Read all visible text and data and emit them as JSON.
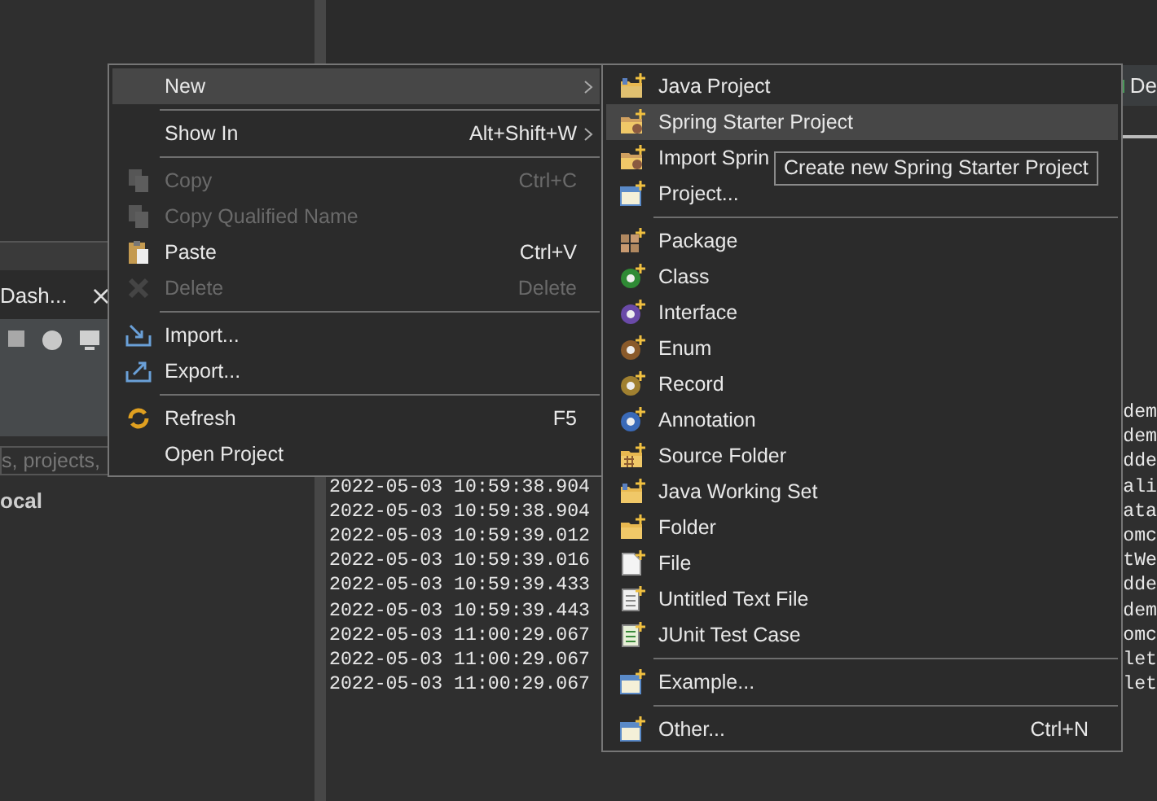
{
  "left_panel": {
    "view_tab": {
      "label": "Dash...",
      "close": "×"
    },
    "search": {
      "placeholder": "s, projects,"
    },
    "tree_item": "ocal"
  },
  "right_panel": {
    "view_tab": {
      "label": "De"
    },
    "console": [
      {
        "text": "dem"
      },
      {
        "text": "dem"
      },
      {
        "text": "dde"
      },
      {
        "time": "2022-05-03 10:59:38.904",
        "text": "ali"
      },
      {
        "time": "2022-05-03 10:59:38.904",
        "text": "ata"
      },
      {
        "time": "2022-05-03 10:59:39.012",
        "text": "omc"
      },
      {
        "time": "2022-05-03 10:59:39.016",
        "text": "tWe"
      },
      {
        "time": "2022-05-03 10:59:39.433",
        "text": "dde"
      },
      {
        "time": "2022-05-03 10:59:39.443",
        "text": "dem"
      },
      {
        "time": "2022-05-03 11:00:29.067",
        "text": "omc"
      },
      {
        "time": "2022-05-03 11:00:29.067",
        "text": "let"
      },
      {
        "time": "2022-05-03 11:00:29.067",
        "text": "let"
      }
    ]
  },
  "context_menu": {
    "items": [
      {
        "kind": "item",
        "label": "New",
        "has_submenu": true,
        "selected": true,
        "disabled": false
      },
      {
        "kind": "separator"
      },
      {
        "kind": "item",
        "label": "Show In",
        "shortcut": "Alt+Shift+W",
        "has_submenu": true,
        "selected": false,
        "disabled": false
      },
      {
        "kind": "separator"
      },
      {
        "kind": "item",
        "label": "Copy",
        "shortcut": "Ctrl+C",
        "has_submenu": false,
        "selected": false,
        "disabled": true
      },
      {
        "kind": "item",
        "label": "Copy Qualified Name",
        "has_submenu": false,
        "selected": false,
        "disabled": true
      },
      {
        "kind": "item",
        "label": "Paste",
        "shortcut": "Ctrl+V",
        "has_submenu": false,
        "selected": false,
        "disabled": false
      },
      {
        "kind": "item",
        "label": "Delete",
        "shortcut": "Delete",
        "has_submenu": false,
        "selected": false,
        "disabled": true
      },
      {
        "kind": "separator"
      },
      {
        "kind": "item",
        "label": "Import...",
        "has_submenu": false,
        "selected": false,
        "disabled": false
      },
      {
        "kind": "item",
        "label": "Export...",
        "has_submenu": false,
        "selected": false,
        "disabled": false
      },
      {
        "kind": "separator"
      },
      {
        "kind": "item",
        "label": "Refresh",
        "shortcut": "F5",
        "has_submenu": false,
        "selected": false,
        "disabled": false
      },
      {
        "kind": "item",
        "label": "Open Project",
        "has_submenu": false,
        "selected": false,
        "disabled": false
      }
    ]
  },
  "new_submenu": {
    "items": [
      {
        "kind": "item",
        "label": "Java Project",
        "selected": false
      },
      {
        "kind": "item",
        "label": "Spring Starter Project",
        "selected": true
      },
      {
        "kind": "item",
        "label": "Import Sprin",
        "selected": false
      },
      {
        "kind": "item",
        "label": "Project...",
        "selected": false
      },
      {
        "kind": "separator"
      },
      {
        "kind": "item",
        "label": "Package",
        "selected": false
      },
      {
        "kind": "item",
        "label": "Class",
        "selected": false
      },
      {
        "kind": "item",
        "label": "Interface",
        "selected": false
      },
      {
        "kind": "item",
        "label": "Enum",
        "selected": false
      },
      {
        "kind": "item",
        "label": "Record",
        "selected": false
      },
      {
        "kind": "item",
        "label": "Annotation",
        "selected": false
      },
      {
        "kind": "item",
        "label": "Source Folder",
        "selected": false
      },
      {
        "kind": "item",
        "label": "Java Working Set",
        "selected": false
      },
      {
        "kind": "item",
        "label": "Folder",
        "selected": false
      },
      {
        "kind": "item",
        "label": "File",
        "selected": false
      },
      {
        "kind": "item",
        "label": "Untitled Text File",
        "selected": false
      },
      {
        "kind": "item",
        "label": "JUnit Test Case",
        "selected": false
      },
      {
        "kind": "separator"
      },
      {
        "kind": "item",
        "label": "Example...",
        "selected": false
      },
      {
        "kind": "separator"
      },
      {
        "kind": "item",
        "label": "Other...",
        "shortcut": "Ctrl+N",
        "selected": false
      }
    ]
  },
  "tooltip": {
    "text": "Create new Spring Starter Project"
  }
}
